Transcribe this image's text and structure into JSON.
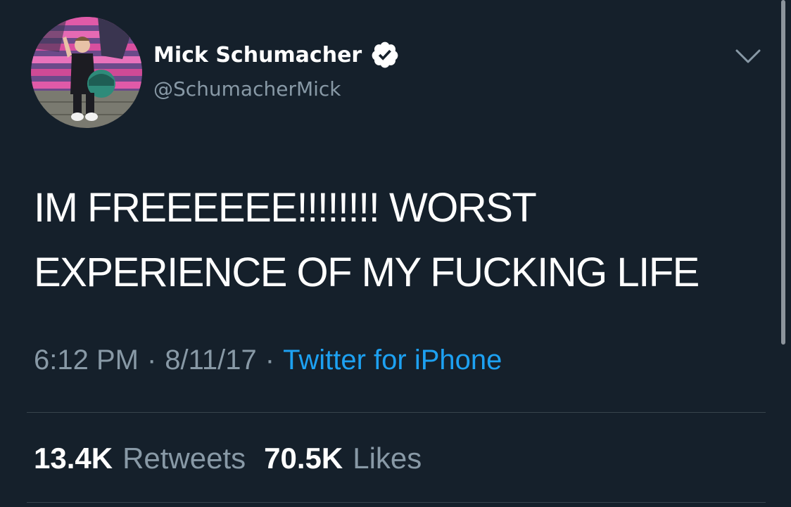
{
  "tweet": {
    "display_name": "Mick Schumacher",
    "handle": "@SchumacherMick",
    "text_line1": "IM FREEEEEE!!!!!!!! WORST",
    "text_line2": "EXPERIENCE OF MY FUCKING LIFE",
    "time": "6:12 PM",
    "separator": "·",
    "date": "8/11/17",
    "source": "Twitter for iPhone",
    "retweets_count": "13.4K",
    "retweets_label": "Retweets",
    "likes_count": "70.5K",
    "likes_label": "Likes"
  },
  "icons": {
    "verified": "verified-badge-icon",
    "menu": "chevron-down-icon"
  },
  "colors": {
    "background": "#15202b",
    "text": "#ffffff",
    "muted": "#8899a6",
    "link": "#1da1f2",
    "divider": "#38444d"
  }
}
